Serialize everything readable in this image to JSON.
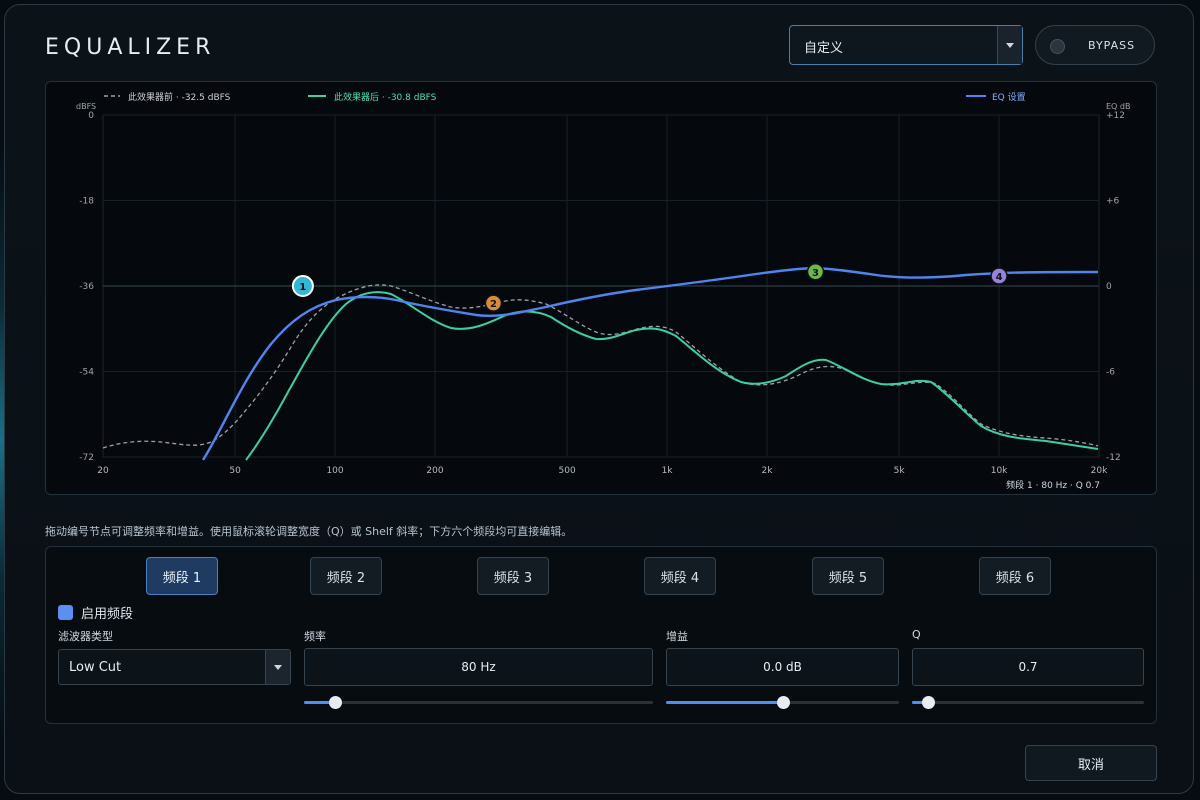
{
  "header": {
    "title": "EQUALIZER",
    "preset_value": "自定义",
    "bypass_label": "BYPASS"
  },
  "graph": {
    "legend_pre": "此效果器前 · -32.5 dBFS",
    "legend_post": "此效果器后 · -30.8 dBFS",
    "legend_eq": "EQ 设置",
    "left_axis_unit": "dBFS",
    "right_axis_unit": "EQ dB",
    "left_ticks": [
      "0",
      "-18",
      "-36",
      "-54",
      "-72"
    ],
    "right_ticks": [
      "+12",
      "+6",
      "0",
      "-6",
      "-12"
    ],
    "x_ticks": [
      "20",
      "50",
      "100",
      "200",
      "500",
      "1k",
      "2k",
      "5k",
      "10k",
      "20k"
    ],
    "status": "频段 1 · 80 Hz · Q 0.7",
    "colors": {
      "pre": "#9aa3ab",
      "post": "#3ecfa0",
      "eq": "#4f86ee"
    },
    "nodes": [
      {
        "label": "1",
        "freq_hz": 80,
        "gain_db": 0,
        "color": "#35b6d6"
      },
      {
        "label": "2",
        "freq_hz": 300,
        "gain_db": -1.2,
        "color": "#d98b3a"
      },
      {
        "label": "3",
        "freq_hz": 2800,
        "gain_db": 1.0,
        "color": "#6fb84a"
      },
      {
        "label": "4",
        "freq_hz": 10000,
        "gain_db": 0.7,
        "color": "#9a82d8"
      }
    ]
  },
  "hint": "拖动编号节点可调整频率和增益。使用鼠标滚轮调整宽度（Q）或 Shelf 斜率；下方六个频段均可直接编辑。",
  "bands": {
    "tabs": [
      "频段 1",
      "频段 2",
      "频段 3",
      "频段 4",
      "频段 5",
      "频段 6"
    ],
    "active_tab": 0,
    "enable_label": "启用频段",
    "filter_type_label": "滤波器类型",
    "filter_type_value": "Low Cut",
    "freq_label": "频率",
    "freq_value": "80 Hz",
    "freq_slider": 0.09,
    "gain_label": "增益",
    "gain_value": "0.0 dB",
    "gain_slider": 0.5,
    "q_label": "Q",
    "q_value": "0.7",
    "q_slider": 0.07
  },
  "footer": {
    "cancel_label": "取消"
  }
}
